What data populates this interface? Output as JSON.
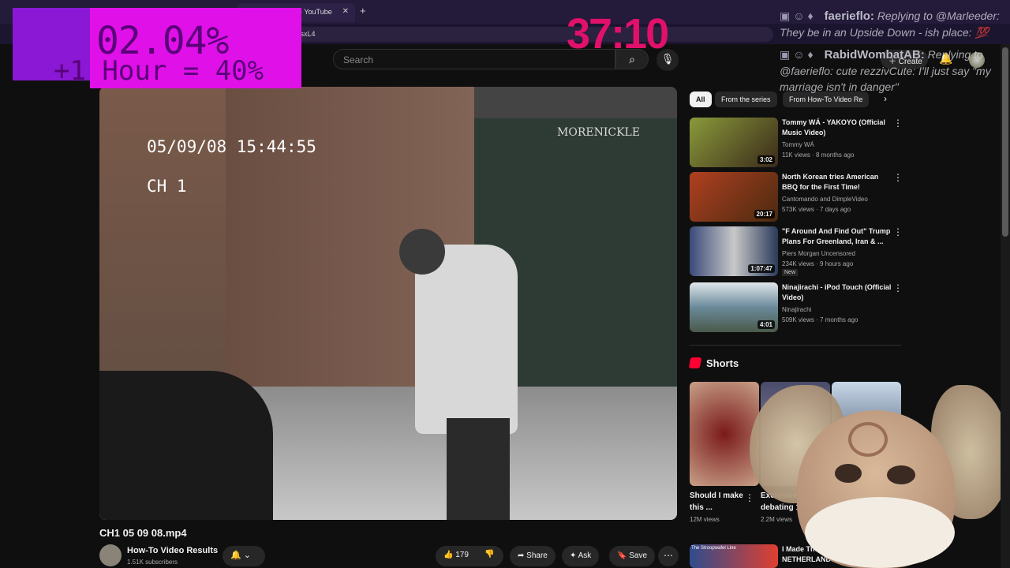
{
  "browser": {
    "tab_title": "mp4 - YouTube",
    "new_tab": "+",
    "url_fragment": "vQ0sxL4"
  },
  "overlay": {
    "percent": "02.04%",
    "hour_rate": "+1 Hour = 40%",
    "timer": "37:10"
  },
  "chat": [
    {
      "user": "faerieflo:",
      "message": "Replying to @Marleeder: They be in an Upside Down - ish place: 💯"
    },
    {
      "user": "RabidWombatAB:",
      "message": "Replying to @faerieflo: cute rezzivCute: I'll just say \"my marriage isn't in danger\""
    }
  ],
  "header": {
    "search_placeholder": "Search",
    "create_label": "Create"
  },
  "video": {
    "timestamp_overlay": "05/09/08 15:44:55",
    "channel_overlay": "CH 1",
    "board_text": "MORENICKLE",
    "title": "CH1 05 09 08.mp4",
    "channel_name": "How-To Video Results",
    "subscribers": "1.51K subscribers",
    "likes": "179",
    "share_label": "Share",
    "ask_label": "Ask",
    "save_label": "Save"
  },
  "chips": [
    {
      "label": "All",
      "active": true
    },
    {
      "label": "From the series",
      "active": false
    },
    {
      "label": "From How-To Video Re",
      "active": false
    }
  ],
  "recommended": [
    {
      "title": "Tommy WÁ - YAKOYO (Official Music Video)",
      "channel": "Tommy WÁ",
      "meta": "11K views · 8 months ago",
      "duration": "3:02",
      "thumb_color": "#6a7a2a"
    },
    {
      "title": "North Korean tries American BBQ for the First Time!",
      "channel": "Cantomando and DimpleVideo",
      "meta": "573K views · 7 days ago",
      "duration": "20:17",
      "thumb_color": "#8a3a1a"
    },
    {
      "title": "\"F Around And Find Out\" Trump Plans For Greenland, Iran & ...",
      "channel": "Piers Morgan Uncensored",
      "meta": "234K views · 9 hours ago",
      "duration": "1:07:47",
      "badge": "New",
      "thumb_color": "#2a3a6a"
    },
    {
      "title": "Ninajirachi - iPod Touch (Official Video)",
      "channel": "Ninajirachi",
      "meta": "509K views · 7 months ago",
      "duration": "4:01",
      "thumb_color": "#7a8a8a"
    }
  ],
  "shorts": {
    "heading": "Shorts",
    "items": [
      {
        "title": "Should I make this ...",
        "views": "12M views",
        "color": "#8a2a2a"
      },
      {
        "title": "Exclusively debating 1...",
        "views": "2.2M views",
        "color": "#3a3a5a"
      }
    ]
  },
  "next_rec": {
    "title": "I Made The INVINC NETHERLANDS in V",
    "thumb_text": "The Stroopwafel Line"
  }
}
